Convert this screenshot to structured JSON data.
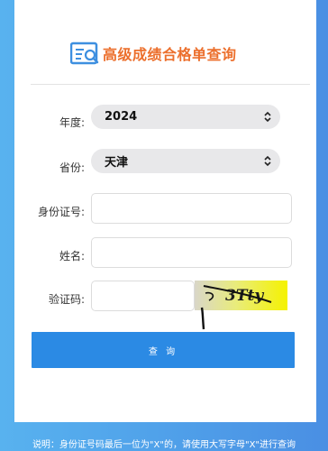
{
  "header": {
    "title": "高级成绩合格单查询",
    "logo_icon": "document-search-icon"
  },
  "form": {
    "year": {
      "label": "年度:",
      "value": "2024"
    },
    "province": {
      "label": "省份:",
      "value": "天津"
    },
    "id_number": {
      "label": "身份证号:",
      "value": ""
    },
    "name": {
      "label": "姓名:",
      "value": ""
    },
    "captcha": {
      "label": "验证码:",
      "value": "",
      "image_text": "3Tty"
    }
  },
  "submit_label": "查 询",
  "note": "说明：身份证号码最后一位为\"X\"的，请使用大写字母\"X\"进行查询",
  "colors": {
    "background": "#4f9fe9",
    "title": "#ec6f2c",
    "button": "#2b8ae4",
    "select_bg": "#e8e8ea",
    "captcha_bg": "#f3f000"
  }
}
